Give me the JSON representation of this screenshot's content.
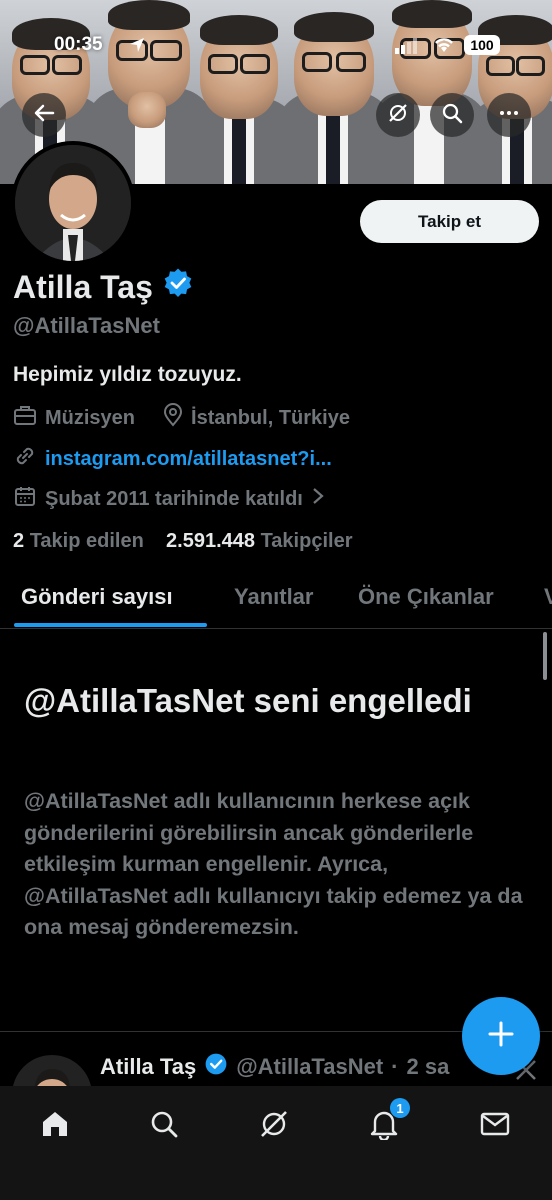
{
  "status_bar": {
    "time": "00:35",
    "battery": "100"
  },
  "profile": {
    "name": "Atilla Taş",
    "handle": "@AtillaTasNet",
    "bio": "Hepimiz yıldız tozuyuz.",
    "occupation": "Müzisyen",
    "location": "İstanbul, Türkiye",
    "link": "instagram.com/atillatasnet?i...",
    "joined": "Şubat 2011 tarihinde katıldı",
    "following_count": "2",
    "following_label": "Takip edilen",
    "followers_count": "2.591.448",
    "followers_label": "Takipçiler",
    "verified_color": "#1d9bf0"
  },
  "buttons": {
    "follow": "Takip et"
  },
  "tabs": [
    {
      "label": "Gönderi sayısı",
      "active": true
    },
    {
      "label": "Yanıtlar"
    },
    {
      "label": "Öne Çıkanlar"
    },
    {
      "label": "V"
    }
  ],
  "blocked": {
    "title": "@AtillaTasNet seni engelledi",
    "text": "@AtillaTasNet adlı kullanıcının herkese açık gönderilerini görebilirsin ancak gönderilerle etkileşim kurman engellenir. Ayrıca, @AtillaTasNet adlı kullanıcıyı takip edemez ya da ona mesaj gönderemezsin."
  },
  "tweet_preview": {
    "name": "Atilla Taş",
    "handle": "@AtillaTasNet",
    "separator": "·",
    "time": "2 sa"
  },
  "nav": {
    "items": [
      "home-icon",
      "search-icon",
      "grok-icon",
      "notifications-icon",
      "messages-icon"
    ],
    "notification_badge": "1"
  },
  "colors": {
    "accent": "#1d9bf0",
    "background": "#000000",
    "muted": "#71767b"
  }
}
